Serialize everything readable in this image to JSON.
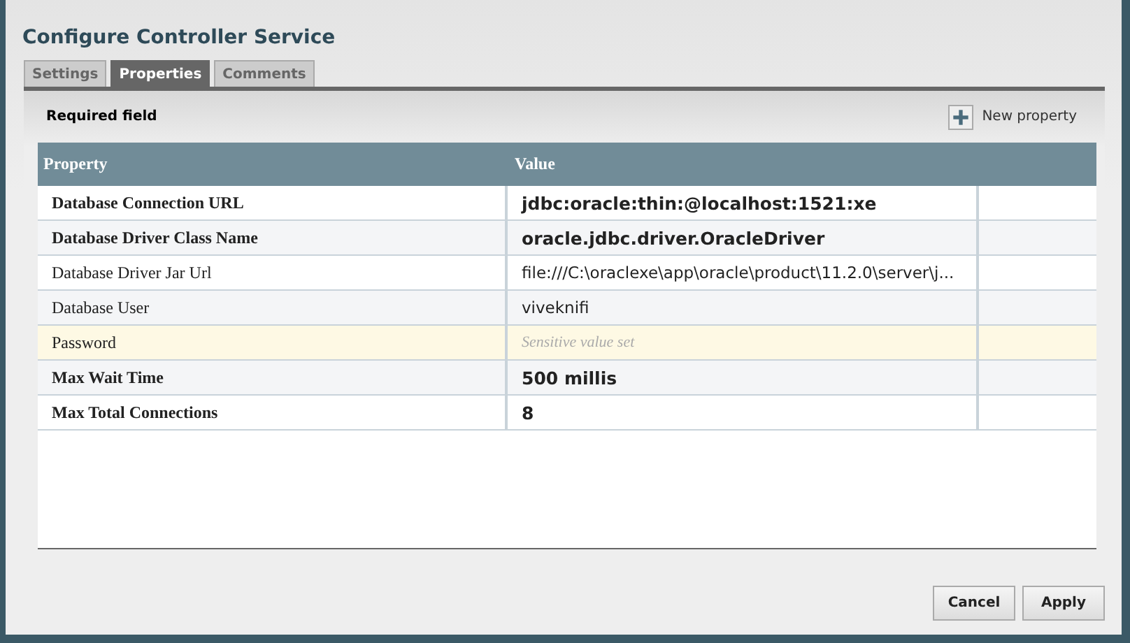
{
  "window": {
    "title": "Configure Controller Service"
  },
  "tabs": [
    {
      "label": "Settings",
      "selected": false
    },
    {
      "label": "Properties",
      "selected": true
    },
    {
      "label": "Comments",
      "selected": false
    }
  ],
  "toolbar": {
    "required_note": "Required field",
    "new_property": "New property"
  },
  "table": {
    "columns": [
      "Property",
      "Value"
    ],
    "rows": [
      {
        "name": "Database Connection URL",
        "value": "jdbc:oracle:thin:@localhost:1521:xe",
        "required": true,
        "kind": "plain"
      },
      {
        "name": "Database Driver Class Name",
        "value": "oracle.jdbc.driver.OracleDriver",
        "required": true,
        "kind": "plain"
      },
      {
        "name": "Database Driver Jar Url",
        "value": "file:///C:\\oraclexe\\app\\oracle\\product\\11.2.0\\server\\j...",
        "required": false,
        "kind": "plain"
      },
      {
        "name": "Database User",
        "value": "viveknifi",
        "required": false,
        "kind": "plain"
      },
      {
        "name": "Password",
        "value": "Sensitive value set",
        "required": false,
        "kind": "sensitive"
      },
      {
        "name": "Max Wait Time",
        "value": "500 millis",
        "required": true,
        "kind": "plain"
      },
      {
        "name": "Max Total Connections",
        "value": "8",
        "required": true,
        "kind": "plain"
      }
    ]
  },
  "buttons": [
    "Cancel",
    "Apply"
  ]
}
